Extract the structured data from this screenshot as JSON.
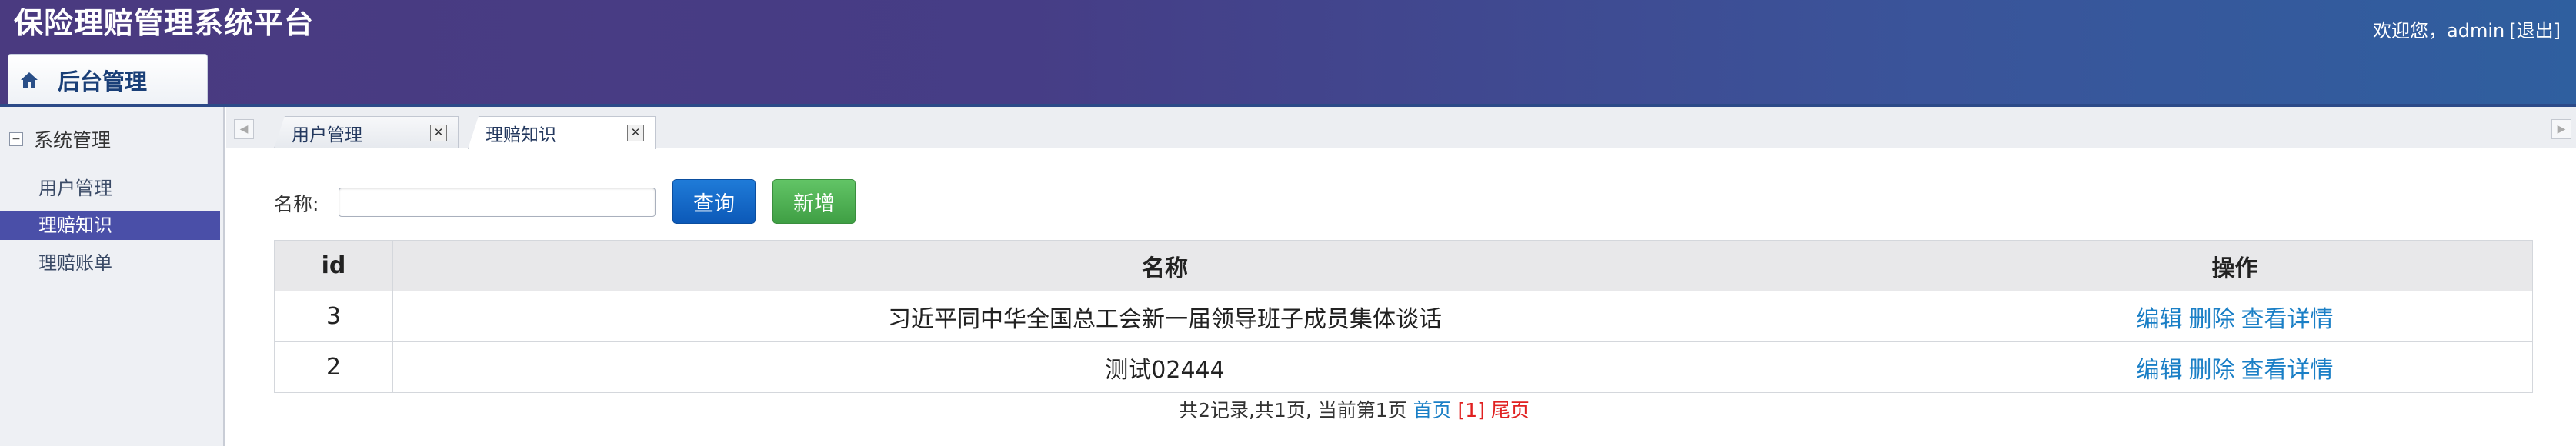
{
  "app": {
    "title": "保险理赔管理系统平台",
    "welcome": "欢迎您，admin",
    "logout": "[退出]"
  },
  "main_tab": {
    "label": "后台管理"
  },
  "sidebar": {
    "group": "系统管理",
    "toggle": "−",
    "items": [
      {
        "label": "用户管理"
      },
      {
        "label": "理赔知识"
      },
      {
        "label": "理赔账单"
      }
    ]
  },
  "tabs": [
    {
      "label": "用户管理"
    },
    {
      "label": "理赔知识"
    }
  ],
  "search": {
    "label": "名称:",
    "value": "",
    "query_label": "查询",
    "add_label": "新增"
  },
  "table": {
    "headers": {
      "id": "id",
      "name": "名称",
      "ops": "操作"
    },
    "rows": [
      {
        "id": "3",
        "name": "习近平同中华全国总工会新一届领导班子成员集体谈话",
        "edit": "编辑",
        "delete": "删除",
        "view": "查看详情"
      },
      {
        "id": "2",
        "name": "测试02444",
        "edit": "编辑",
        "delete": "删除",
        "view": "查看详情"
      }
    ]
  },
  "pager": {
    "summary": "共2记录,共1页, 当前第1页",
    "first": "首页",
    "current": "[1]",
    "last": "尾页"
  },
  "colors": {
    "header_start": "#4a3a80",
    "header_end": "#2f5f9f",
    "sidebar_active": "#4a4fa8",
    "query_button": "#0c59b8",
    "add_button": "#3f9f44",
    "link": "#1a7fc6",
    "current_page": "#e02020"
  }
}
